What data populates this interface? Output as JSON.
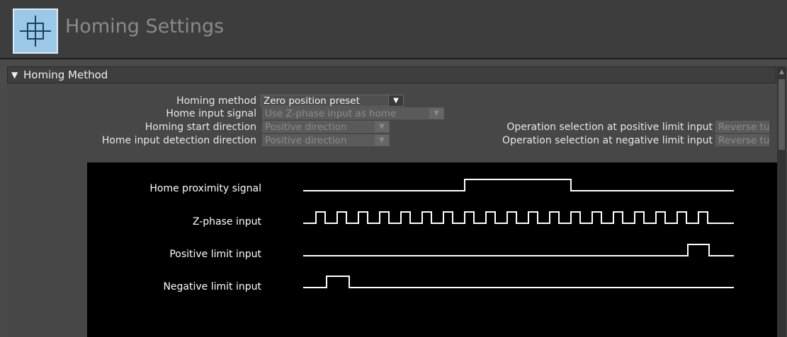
{
  "header": {
    "title": "Homing Settings",
    "icon": "crosshair-icon",
    "accent_color": "#9bc7e8"
  },
  "section": {
    "title": "Homing Method",
    "expanded": true
  },
  "fields": {
    "homing_method": {
      "label": "Homing method",
      "value": "Zero position preset",
      "enabled": true
    },
    "home_input_signal": {
      "label": "Home input signal",
      "value": "Use Z-phase input as home",
      "enabled": false
    },
    "homing_start_direction": {
      "label": "Homing start direction",
      "value": "Positive direction",
      "enabled": false
    },
    "home_input_detection_direction": {
      "label": "Home input detection direction",
      "value": "Positive direction",
      "enabled": false
    },
    "op_positive_limit": {
      "label": "Operation selection at positive limit input",
      "value": "Reverse tu",
      "enabled": false
    },
    "op_negative_limit": {
      "label": "Operation selection at negative limit input",
      "value": "Reverse tu",
      "enabled": false
    }
  },
  "diagram": {
    "signals": [
      {
        "label": "Home proximity signal"
      },
      {
        "label": "Z-phase input"
      },
      {
        "label": "Positive limit input"
      },
      {
        "label": "Negative limit input"
      }
    ]
  }
}
